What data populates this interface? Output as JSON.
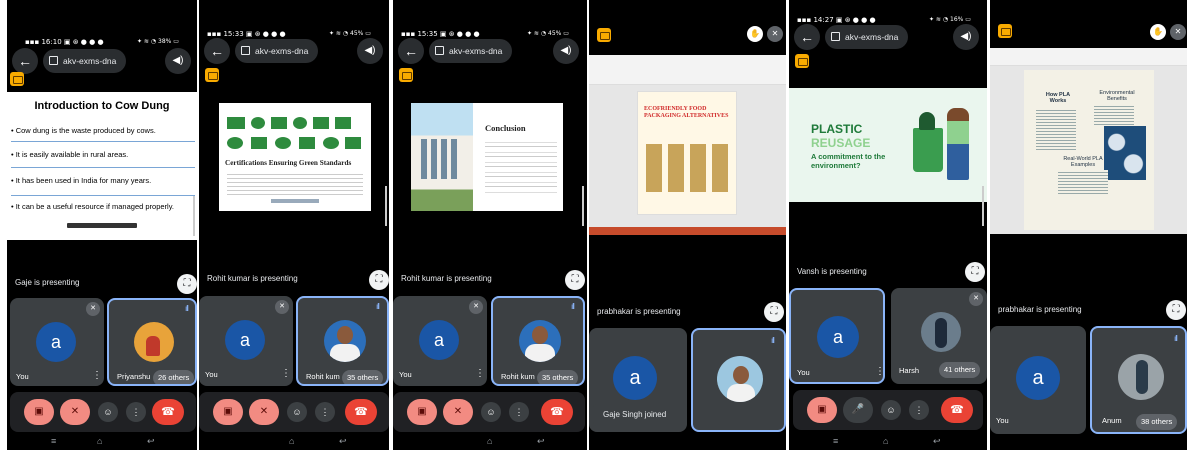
{
  "meeting_code": "akv-exms-dna",
  "screens": [
    {
      "time": "16:10",
      "battery": "38%",
      "slide": {
        "title": "Introduction to Cow Dung",
        "bullets": [
          "• Cow dung is the waste produced by cows.",
          "• It is easily available in rural areas.",
          "• It has been used in India for many years.",
          "• It can be a useful resource if managed properly."
        ]
      },
      "presenting": "Gaje is presenting",
      "tiles": [
        {
          "name": "You",
          "avatar": "a"
        },
        {
          "name": "Priyanshu",
          "others": "26 others"
        }
      ]
    },
    {
      "time": "15:33",
      "battery": "45%",
      "slide": {
        "heading": "Certifications Ensuring Green Standards"
      },
      "presenting": "Rohit kumar is presenting",
      "tiles": [
        {
          "name": "You",
          "avatar": "a"
        },
        {
          "name": "Rohit kum",
          "others": "35 others"
        }
      ]
    },
    {
      "time": "15:35",
      "battery": "45%",
      "slide": {
        "heading": "Conclusion"
      },
      "presenting": "Rohit kumar is presenting",
      "tiles": [
        {
          "name": "You",
          "avatar": "a"
        },
        {
          "name": "Rohit kum",
          "others": "35 others"
        }
      ]
    },
    {
      "slide": {
        "heading": "ECOFRIENDLY FOOD PACKAGING ALTERNATIVES"
      },
      "presenting": "prabhakar is presenting",
      "tiles": [
        {
          "avatar": "a"
        },
        {}
      ],
      "toast": "Gaje Singh joined"
    },
    {
      "time": "14:27",
      "battery": "16%",
      "slide": {
        "title1": "PLASTIC",
        "title2": "REUSAGE",
        "subtitle": "A commitment to the environment?"
      },
      "presenting": "Vansh is presenting",
      "tiles": [
        {
          "name": "You",
          "avatar": "a"
        },
        {
          "name": "Harsh",
          "others": "41 others"
        }
      ]
    },
    {
      "slide": {
        "col1": "How PLA Works",
        "col2": "Environmental Benefits",
        "col3": "Real-World PLA Examples"
      },
      "presenting": "prabhakar is presenting",
      "tiles": [
        {
          "name": "You",
          "avatar": "a"
        },
        {
          "name": "Anum",
          "others": "38 others"
        }
      ]
    }
  ],
  "icons": {
    "back": "←",
    "speaker": "🔊",
    "expand": "⛶",
    "camera_off": "camera-off-icon",
    "mic_off": "mic-off-icon",
    "emoji": "☺",
    "more": "⋮",
    "end_call": "end-call-icon"
  },
  "colors": {
    "accent_blue": "#8ab4f8",
    "avatar_blue": "#1a56a6",
    "end_red": "#ea4335",
    "off_pink": "#f28b82",
    "badge_yellow": "#f9ab00"
  }
}
